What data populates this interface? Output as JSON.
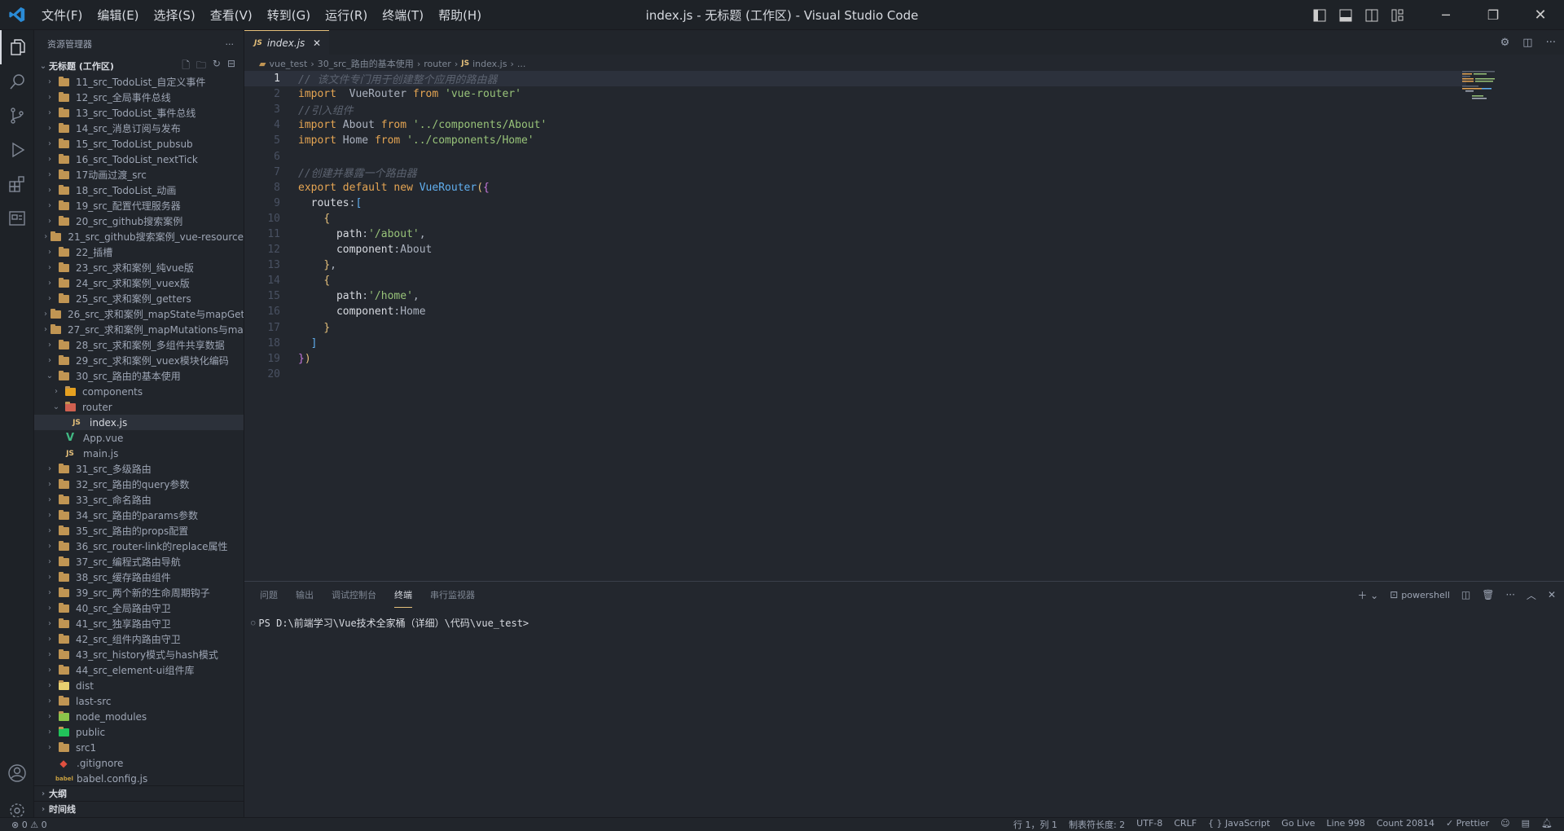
{
  "title": {
    "app_title": "index.js - 无标题 (工作区) - Visual Studio Code",
    "menu": [
      "文件(F)",
      "编辑(E)",
      "选择(S)",
      "查看(V)",
      "转到(G)",
      "运行(R)",
      "终端(T)",
      "帮助(H)"
    ]
  },
  "sidebar": {
    "title": "资源管理器",
    "more": "···",
    "workspace": "无标题 (工作区)",
    "items": [
      {
        "label": "11_src_TodoList_自定义事件",
        "type": "folder",
        "depth": 0
      },
      {
        "label": "12_src_全局事件总线",
        "type": "folder",
        "depth": 0
      },
      {
        "label": "13_src_TodoList_事件总线",
        "type": "folder",
        "depth": 0
      },
      {
        "label": "14_src_消息订阅与发布",
        "type": "folder",
        "depth": 0
      },
      {
        "label": "15_src_TodoList_pubsub",
        "type": "folder",
        "depth": 0
      },
      {
        "label": "16_src_TodoList_nextTick",
        "type": "folder",
        "depth": 0
      },
      {
        "label": "17动画过渡_src",
        "type": "folder",
        "depth": 0
      },
      {
        "label": "18_src_TodoList_动画",
        "type": "folder",
        "depth": 0
      },
      {
        "label": "19_src_配置代理服务器",
        "type": "folder",
        "depth": 0
      },
      {
        "label": "20_src_github搜索案例",
        "type": "folder",
        "depth": 0
      },
      {
        "label": "21_src_github搜索案例_vue-resource",
        "type": "folder",
        "depth": 0
      },
      {
        "label": "22_插槽",
        "type": "folder",
        "depth": 0
      },
      {
        "label": "23_src_求和案例_纯vue版",
        "type": "folder",
        "depth": 0
      },
      {
        "label": "24_src_求和案例_vuex版",
        "type": "folder",
        "depth": 0
      },
      {
        "label": "25_src_求和案例_getters",
        "type": "folder",
        "depth": 0
      },
      {
        "label": "26_src_求和案例_mapState与mapGetters",
        "type": "folder",
        "depth": 0
      },
      {
        "label": "27_src_求和案例_mapMutations与map...",
        "type": "folder",
        "depth": 0
      },
      {
        "label": "28_src_求和案例_多组件共享数据",
        "type": "folder",
        "depth": 0
      },
      {
        "label": "29_src_求和案例_vuex模块化编码",
        "type": "folder",
        "depth": 0
      },
      {
        "label": "30_src_路由的基本使用",
        "type": "folder-open",
        "depth": 0
      },
      {
        "label": "components",
        "type": "folder-components",
        "depth": 1
      },
      {
        "label": "router",
        "type": "folder-router-open",
        "depth": 1
      },
      {
        "label": "index.js",
        "type": "js",
        "depth": 2,
        "selected": true
      },
      {
        "label": "App.vue",
        "type": "vue",
        "depth": 1
      },
      {
        "label": "main.js",
        "type": "js",
        "depth": 1
      },
      {
        "label": "31_src_多级路由",
        "type": "folder",
        "depth": 0
      },
      {
        "label": "32_src_路由的query参数",
        "type": "folder",
        "depth": 0
      },
      {
        "label": "33_src_命名路由",
        "type": "folder",
        "depth": 0
      },
      {
        "label": "34_src_路由的params参数",
        "type": "folder",
        "depth": 0
      },
      {
        "label": "35_src_路由的props配置",
        "type": "folder",
        "depth": 0
      },
      {
        "label": "36_src_router-link的replace属性",
        "type": "folder",
        "depth": 0
      },
      {
        "label": "37_src_编程式路由导航",
        "type": "folder",
        "depth": 0
      },
      {
        "label": "38_src_缓存路由组件",
        "type": "folder",
        "depth": 0
      },
      {
        "label": "39_src_两个新的生命周期钩子",
        "type": "folder",
        "depth": 0
      },
      {
        "label": "40_src_全局路由守卫",
        "type": "folder",
        "depth": 0
      },
      {
        "label": "41_src_独享路由守卫",
        "type": "folder",
        "depth": 0
      },
      {
        "label": "42_src_组件内路由守卫",
        "type": "folder",
        "depth": 0
      },
      {
        "label": "43_src_history模式与hash模式",
        "type": "folder",
        "depth": 0
      },
      {
        "label": "44_src_element-ui组件库",
        "type": "folder",
        "depth": 0
      },
      {
        "label": "dist",
        "type": "folder-dist",
        "depth": 0
      },
      {
        "label": "last-src",
        "type": "folder",
        "depth": 0
      },
      {
        "label": "node_modules",
        "type": "folder-node",
        "depth": 0
      },
      {
        "label": "public",
        "type": "folder-public",
        "depth": 0
      },
      {
        "label": "src1",
        "type": "folder",
        "depth": 0
      },
      {
        "label": ".gitignore",
        "type": "git",
        "depth": 0
      },
      {
        "label": "babel.config.js",
        "type": "babel",
        "depth": 0
      }
    ],
    "outline": "大纲",
    "timeline": "时间线"
  },
  "editor": {
    "tab_icon": "JS",
    "tab_label": "index.js",
    "breadcrumb": [
      "vue_test",
      "30_src_路由的基本使用",
      "router",
      "index.js",
      "..."
    ],
    "lines": [
      [
        [
          "cm",
          "// 该文件专门用于创建整个应用的路由器"
        ]
      ],
      [
        [
          "kw",
          "import"
        ],
        [
          "",
          "  VueRouter "
        ],
        [
          "kw",
          "from"
        ],
        [
          "",
          " "
        ],
        [
          "str",
          "'vue-router'"
        ]
      ],
      [
        [
          "cm",
          "//引入组件"
        ]
      ],
      [
        [
          "kw",
          "import"
        ],
        [
          "",
          " About "
        ],
        [
          "kw",
          "from"
        ],
        [
          "",
          " "
        ],
        [
          "str",
          "'../components/About'"
        ]
      ],
      [
        [
          "kw",
          "import"
        ],
        [
          "",
          " Home "
        ],
        [
          "kw",
          "from"
        ],
        [
          "",
          " "
        ],
        [
          "str",
          "'../components/Home'"
        ]
      ],
      [],
      [
        [
          "cm",
          "//创建并暴露一个路由器"
        ]
      ],
      [
        [
          "kw",
          "export"
        ],
        [
          "",
          " "
        ],
        [
          "kw",
          "default"
        ],
        [
          "",
          " "
        ],
        [
          "kw",
          "new"
        ],
        [
          "",
          " "
        ],
        [
          "cls",
          "VueRouter"
        ],
        [
          "b1",
          "("
        ],
        [
          "b2",
          "{"
        ]
      ],
      [
        [
          "",
          "  "
        ],
        [
          "prop",
          "routes"
        ],
        [
          "",
          ":"
        ],
        [
          "b3",
          "["
        ]
      ],
      [
        [
          "",
          "    "
        ],
        [
          "b1",
          "{"
        ]
      ],
      [
        [
          "",
          "      "
        ],
        [
          "prop",
          "path"
        ],
        [
          "",
          ":"
        ],
        [
          "str",
          "'/about'"
        ],
        [
          "",
          ","
        ]
      ],
      [
        [
          "",
          "      "
        ],
        [
          "prop",
          "component"
        ],
        [
          "",
          ":About"
        ]
      ],
      [
        [
          "",
          "    "
        ],
        [
          "b1",
          "}"
        ],
        [
          "",
          ","
        ]
      ],
      [
        [
          "",
          "    "
        ],
        [
          "b1",
          "{"
        ]
      ],
      [
        [
          "",
          "      "
        ],
        [
          "prop",
          "path"
        ],
        [
          "",
          ":"
        ],
        [
          "str",
          "'/home'"
        ],
        [
          "",
          ","
        ]
      ],
      [
        [
          "",
          "      "
        ],
        [
          "prop",
          "component"
        ],
        [
          "",
          ":Home"
        ]
      ],
      [
        [
          "",
          "    "
        ],
        [
          "b1",
          "}"
        ]
      ],
      [
        [
          "",
          "  "
        ],
        [
          "b3",
          "]"
        ]
      ],
      [
        [
          "b2",
          "}"
        ],
        [
          "b1",
          ")"
        ]
      ],
      []
    ]
  },
  "panel": {
    "tabs": [
      "问题",
      "输出",
      "调试控制台",
      "终端",
      "串行监视器"
    ],
    "active": "终端",
    "shell": "powershell",
    "prompt": "PS D:\\前端学习\\Vue技术全家桶（详细）\\代码\\vue_test>"
  },
  "status": {
    "errors": "0",
    "warnings": "0",
    "items": [
      "行 1，列 1",
      "制表符长度: 2",
      "UTF-8",
      "CRLF",
      "{ } JavaScript",
      "Go Live",
      "Line 998",
      "Count 20814",
      "✓ Prettier"
    ]
  }
}
